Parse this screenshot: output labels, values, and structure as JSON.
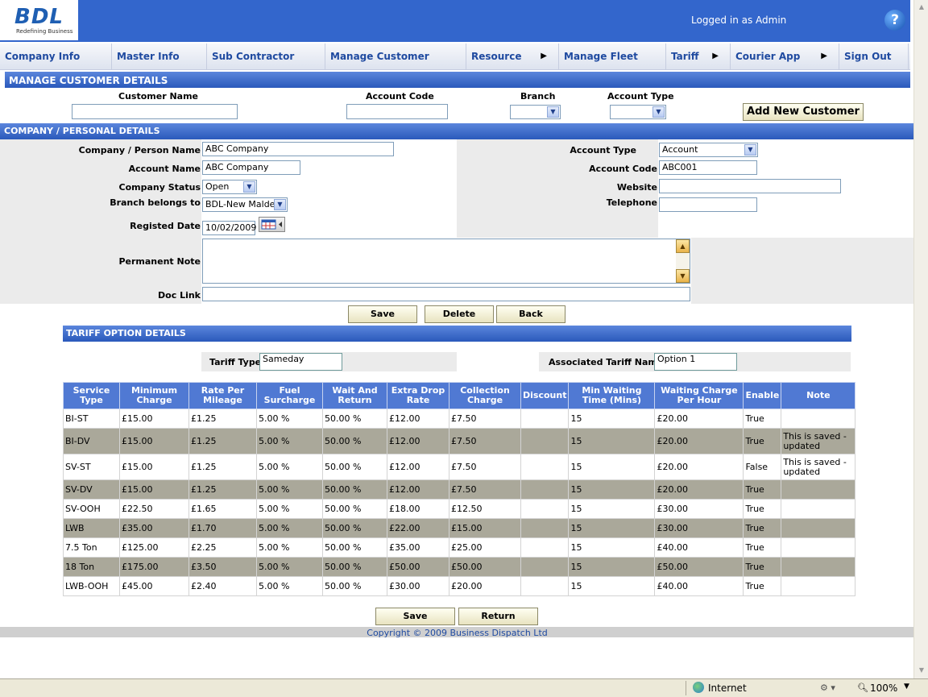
{
  "header": {
    "logo_text": "BDL",
    "logo_tagline": "Redefining Business",
    "logged_in": "Logged in as Admin",
    "help": "?"
  },
  "menu": [
    {
      "label": "Company Info"
    },
    {
      "label": "Master Info"
    },
    {
      "label": "Sub Contractor"
    },
    {
      "label": "Manage Customer"
    },
    {
      "label": "Resource",
      "arrow": "▶"
    },
    {
      "label": "Manage Fleet"
    },
    {
      "label": "Tariff",
      "arrow": "▶"
    },
    {
      "label": "Courier App",
      "arrow": "▶"
    },
    {
      "label": "Sign Out"
    }
  ],
  "manage": {
    "title": "MANAGE CUSTOMER DETAILS",
    "customer_name_label": "Customer Name",
    "customer_name_value": "",
    "account_code_label": "Account Code",
    "account_code_value": "",
    "branch_label": "Branch",
    "branch_value": "",
    "account_type_label": "Account Type",
    "account_type_value": "",
    "add_button": "Add New Customer"
  },
  "company": {
    "title": "COMPANY / PERSONAL DETAILS",
    "person_name_label": "Company / Person Name",
    "person_name_value": "ABC Company",
    "account_name_label": "Account Name",
    "account_name_value": "ABC Company",
    "status_label": "Company Status",
    "status_value": "Open",
    "branch_label": "Branch belongs to",
    "branch_value": "BDL-New Malden",
    "reg_date_label": "Registed Date",
    "reg_date_value": "10/02/2009",
    "account_type_label": "Account Type",
    "account_type_value": "Account",
    "account_code_label": "Account Code",
    "account_code_value": "ABC001",
    "website_label": "Website",
    "website_value": "",
    "telephone_label": "Telephone",
    "telephone_value": "",
    "note_label": "Permanent Note",
    "note_value": "",
    "doclink_label": "Doc Link",
    "doclink_value": "",
    "save": "Save",
    "delete": "Delete",
    "back": "Back"
  },
  "tariff": {
    "title": "TARIFF OPTION DETAILS",
    "type_label": "Tariff Type",
    "type_value": "Sameday",
    "assoc_label": "Associated Tariff Name",
    "assoc_value": "Option 1",
    "columns": [
      "Service Type",
      "Minimum Charge",
      "Rate Per Mileage",
      "Fuel Surcharge",
      "Wait And Return",
      "Extra Drop Rate",
      "Collection Charge",
      "Discount",
      "Min Waiting Time (Mins)",
      "Waiting Charge Per Hour",
      "Enable",
      "Note"
    ],
    "rows": [
      [
        "BI-ST",
        "£15.00",
        "£1.25",
        "5.00 %",
        "50.00 %",
        "£12.00",
        "£7.50",
        "",
        "15",
        "£20.00",
        "True",
        ""
      ],
      [
        "BI-DV",
        "£15.00",
        "£1.25",
        "5.00 %",
        "50.00 %",
        "£12.00",
        "£7.50",
        "",
        "15",
        "£20.00",
        "True",
        "This is saved - updated"
      ],
      [
        "SV-ST",
        "£15.00",
        "£1.25",
        "5.00 %",
        "50.00 %",
        "£12.00",
        "£7.50",
        "",
        "15",
        "£20.00",
        "False",
        "This is saved - updated"
      ],
      [
        "SV-DV",
        "£15.00",
        "£1.25",
        "5.00 %",
        "50.00 %",
        "£12.00",
        "£7.50",
        "",
        "15",
        "£20.00",
        "True",
        ""
      ],
      [
        "SV-OOH",
        "£22.50",
        "£1.65",
        "5.00 %",
        "50.00 %",
        "£18.00",
        "£12.50",
        "",
        "15",
        "£30.00",
        "True",
        ""
      ],
      [
        "LWB",
        "£35.00",
        "£1.70",
        "5.00 %",
        "50.00 %",
        "£22.00",
        "£15.00",
        "",
        "15",
        "£30.00",
        "True",
        ""
      ],
      [
        "7.5 Ton",
        "£125.00",
        "£2.25",
        "5.00 %",
        "50.00 %",
        "£35.00",
        "£25.00",
        "",
        "15",
        "£40.00",
        "True",
        ""
      ],
      [
        "18 Ton",
        "£175.00",
        "£3.50",
        "5.00 %",
        "50.00 %",
        "£50.00",
        "£50.00",
        "",
        "15",
        "£50.00",
        "True",
        ""
      ],
      [
        "LWB-OOH",
        "£45.00",
        "£2.40",
        "5.00 %",
        "50.00 %",
        "£30.00",
        "£20.00",
        "",
        "15",
        "£40.00",
        "True",
        ""
      ]
    ],
    "save": "Save",
    "return": "Return"
  },
  "footer": {
    "copyright": "Copyright © 2009 Business Dispatch Ltd"
  },
  "statusbar": {
    "zone": "Internet",
    "zoom": "100%"
  }
}
